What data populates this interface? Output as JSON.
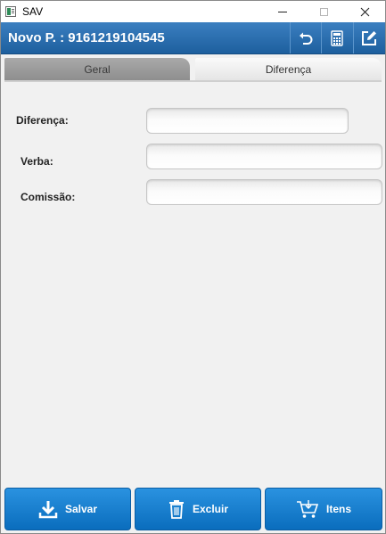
{
  "window": {
    "title": "SAV",
    "icons": {
      "app": "app-icon",
      "minimize": "minimize-icon",
      "maximize": "maximize-icon",
      "close": "close-icon"
    }
  },
  "header": {
    "title": "Novo P. : 9161219104545",
    "actions": [
      {
        "icon": "undo-icon"
      },
      {
        "icon": "calculator-icon"
      },
      {
        "icon": "edit-icon"
      }
    ]
  },
  "tabs": [
    {
      "label": "Geral",
      "active": true
    },
    {
      "label": "Diferença",
      "active": false
    }
  ],
  "form": {
    "diferenca": {
      "label": "Diferença:",
      "value": ""
    },
    "verba": {
      "label": "Verba:",
      "value": ""
    },
    "comissao": {
      "label": "Comissão:",
      "value": ""
    }
  },
  "footer": {
    "salvar": {
      "label": "Salvar",
      "icon": "download-icon"
    },
    "excluir": {
      "label": "Excluir",
      "icon": "trash-icon"
    },
    "itens": {
      "label": "Itens",
      "icon": "cart-icon"
    }
  },
  "colors": {
    "header": "#1d5f9e",
    "button": "#0a6dbd",
    "background": "#f1f1f1"
  }
}
